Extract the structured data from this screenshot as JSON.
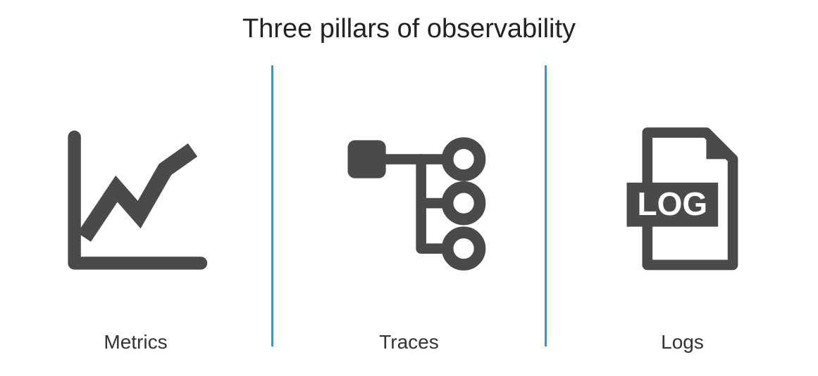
{
  "title": "Three pillars of observability",
  "pillars": [
    {
      "label": "Metrics",
      "icon": "metrics-chart-icon"
    },
    {
      "label": "Traces",
      "icon": "traces-tree-icon"
    },
    {
      "label": "Logs",
      "icon": "logs-file-icon"
    }
  ],
  "colors": {
    "icon": "#4a4a4a",
    "divider": "#1b9af7",
    "text": "#222222"
  }
}
